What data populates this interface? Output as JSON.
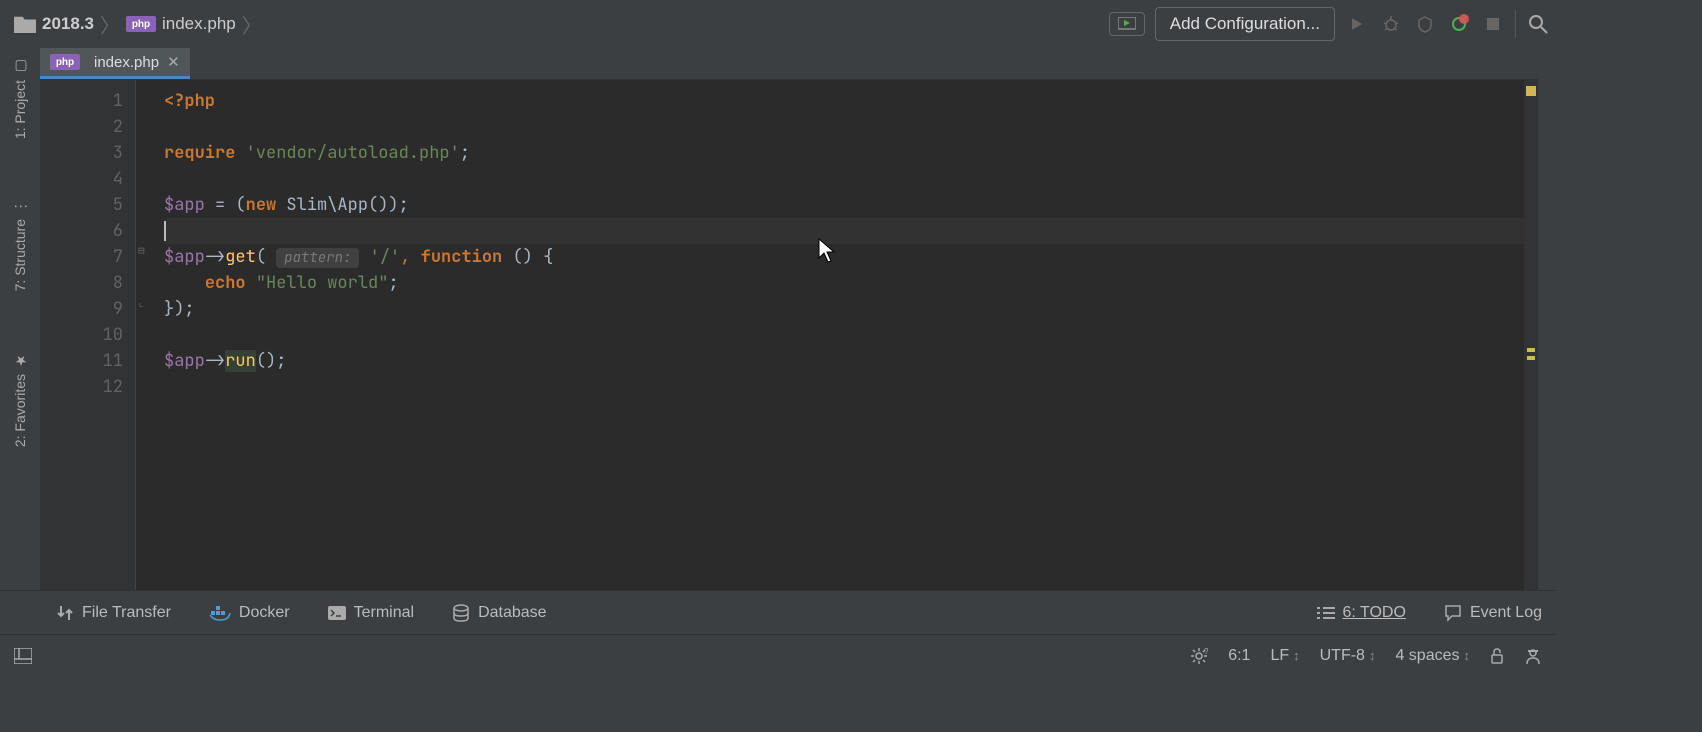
{
  "breadcrumb": {
    "project": "2018.3",
    "file": "index.php",
    "php_badge": "php"
  },
  "toolbar": {
    "add_config": "Add Configuration..."
  },
  "left_tools": {
    "project": "1: Project",
    "structure": "7: Structure",
    "favorites": "2: Favorites"
  },
  "tab": {
    "filename": "index.php",
    "php_badge": "php"
  },
  "gutter": {
    "lines": [
      "1",
      "2",
      "3",
      "4",
      "5",
      "6",
      "7",
      "8",
      "9",
      "10",
      "11",
      "12"
    ]
  },
  "code": {
    "l1_open": "<?php",
    "l3_require": "require",
    "l3_str": "'vendor/autoload.php'",
    "l3_semi": ";",
    "l5_var": "$app",
    "l5_eq": " = (",
    "l5_new": "new",
    "l5_cls": " Slim\\App());",
    "l7_var": "$app",
    "l7_arrow": "->",
    "l7_get": "get",
    "l7_open": "(",
    "l7_hint": "pattern:",
    "l7_path": " '/'",
    "l7_comma": ",",
    "l7_func": " function",
    "l7_rest": " () {",
    "l8_echo": "echo",
    "l8_str": " \"Hello world\"",
    "l8_semi": ";",
    "l9_close": "});",
    "l11_var": "$app",
    "l11_arrow": "->",
    "l11_run": "run",
    "l11_end": "();"
  },
  "bottom_tools": {
    "file_transfer": "File Transfer",
    "docker": "Docker",
    "terminal": "Terminal",
    "database": "Database",
    "todo": "6: TODO",
    "event_log": "Event Log"
  },
  "status": {
    "position": "6:1",
    "line_sep": "LF",
    "encoding": "UTF-8",
    "indent": "4 spaces"
  }
}
